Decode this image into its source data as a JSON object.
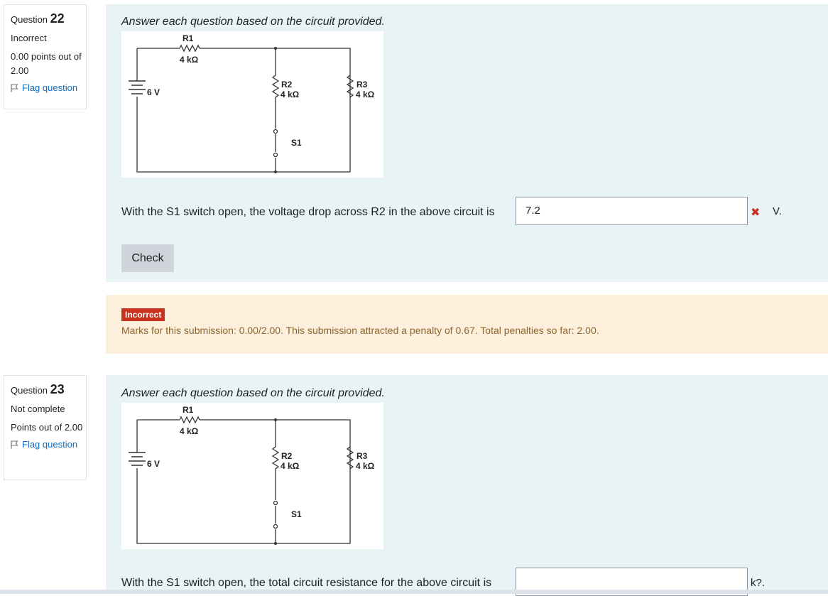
{
  "q22": {
    "label": "Question",
    "number": "22",
    "state": "Incorrect",
    "grade": "0.00 points out of 2.00",
    "flag": "Flag question",
    "prompt": "Answer each question based on the circuit provided.",
    "question_text": "With the S1 switch open, the voltage drop across R2 in the above circuit is",
    "answer_value": "7.2",
    "answer_unit": "V.",
    "result_icon": "cross-icon",
    "check_label": "Check",
    "feedback": {
      "badge": "Incorrect",
      "marks": "Marks for this submission: 0.00/2.00. This submission attracted a penalty of 0.67. Total penalties so far: 2.00."
    }
  },
  "q23": {
    "label": "Question",
    "number": "23",
    "state": "Not complete",
    "grade": "Points out of 2.00",
    "flag": "Flag question",
    "prompt": "Answer each question based on the circuit provided.",
    "question_text": "With the S1 switch open, the total circuit resistance for the above circuit is",
    "answer_value": "",
    "answer_unit": "k?."
  },
  "circuit": {
    "r1_name": "R1",
    "r1_value": "4 kΩ",
    "r2_name": "R2",
    "r2_value": "4 kΩ",
    "r3_name": "R3",
    "r3_value": "4 kΩ",
    "source": "6 V",
    "switch": "S1"
  },
  "colors": {
    "formulation_bg": "#e7f3f5",
    "outcome_bg": "#fcefdc",
    "incorrect_red": "#ca3120",
    "link_blue": "#0f6cbf",
    "feedback_text": "#8e662e"
  }
}
